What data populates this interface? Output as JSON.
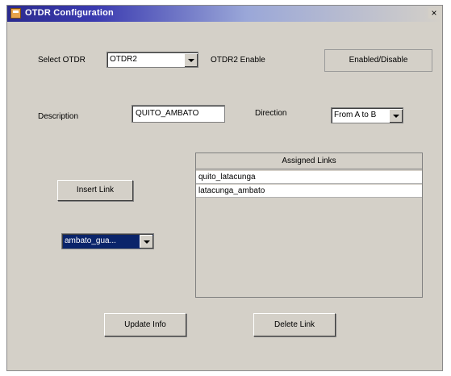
{
  "window": {
    "title": "OTDR Configuration",
    "close_glyph": "×"
  },
  "otdr": {
    "select_label": "Select OTDR",
    "selected_value": "OTDR2",
    "enable_label": "OTDR2 Enable",
    "enable_button": "Enabled/Disable"
  },
  "description": {
    "label": "Description",
    "value": "QUITO_AMBATO"
  },
  "direction": {
    "label": "Direction",
    "value": "From A to B"
  },
  "links": {
    "insert_button": "Insert Link",
    "link_select_value": "ambato_gua...",
    "assigned_header": "Assigned Links",
    "assigned": [
      "quito_latacunga",
      "latacunga_ambato"
    ]
  },
  "actions": {
    "update_button": "Update Info",
    "delete_button": "Delete Link"
  },
  "icons": {
    "window_icon": "app-icon",
    "dropdown_icon": "chevron-down-icon",
    "close_icon": "close-icon"
  }
}
